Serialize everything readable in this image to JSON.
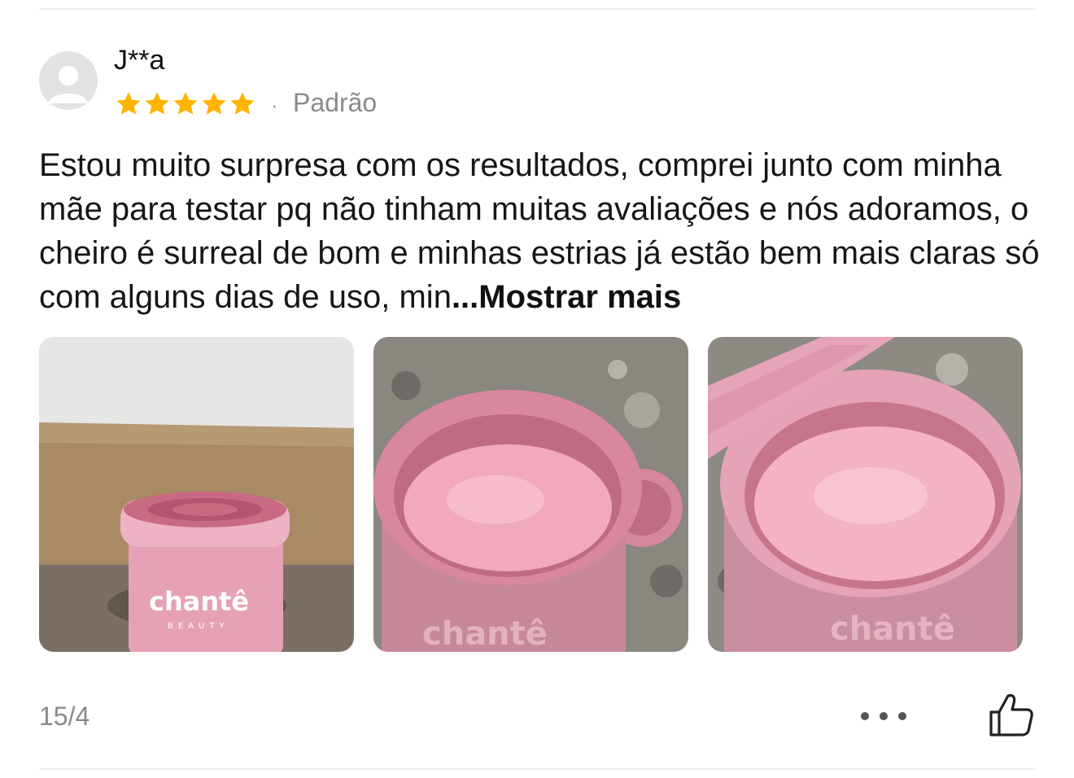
{
  "review": {
    "username": "J**a",
    "rating": 5,
    "rating_max": 5,
    "separator": "·",
    "variant": "Padrão",
    "text": "Estou muito surpresa com os resultados, comprei junto com minha mãe para testar pq não tinham muitas avaliações e nós adoramos, o cheiro é surreal de bom e minhas estrias já estão bem mais claras só com alguns dias de uso, min",
    "show_more_label": "...Mostrar mais",
    "date": "15/4"
  },
  "photos": [
    {
      "label": "chantê",
      "sublabel": "BEAUTY"
    },
    {
      "label": "chantê"
    },
    {
      "label": "chantê"
    }
  ],
  "colors": {
    "star": "#FFB400",
    "text": "#161616",
    "muted": "#8a8a8a",
    "divider": "#ececec",
    "avatar_bg": "#e3e3e3"
  },
  "icons": {
    "avatar": "user-avatar-icon",
    "star": "star-icon",
    "more": "more-options-icon",
    "like": "thumbs-up-icon"
  }
}
